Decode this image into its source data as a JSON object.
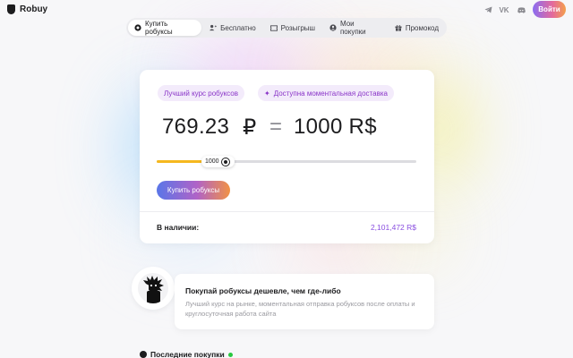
{
  "header": {
    "brand": "Robuy",
    "login_label": "Войти",
    "social": [
      "telegram-icon",
      "vk-icon",
      "discord-icon"
    ]
  },
  "nav": {
    "tabs": [
      {
        "label": "Купить робуксы",
        "icon": "robux-icon",
        "active": true
      },
      {
        "label": "Бесплатно",
        "icon": "user-plus-icon",
        "active": false
      },
      {
        "label": "Розыгрыш",
        "icon": "ticket-icon",
        "active": false
      },
      {
        "label": "Мои покупки",
        "icon": "user-circle-icon",
        "active": false
      },
      {
        "label": "Промокод",
        "icon": "gift-icon",
        "active": false
      }
    ]
  },
  "exchange": {
    "tag_best_rate": "Лучший курс робуксов",
    "tag_instant": "Доступна моментальная доставка",
    "rub_amount": "769.23",
    "rub_sign": "₽",
    "equals": "=",
    "robux_amount": "1000 R$",
    "slider_value": "1000",
    "slider_fill_fraction": 0.19,
    "buy_label": "Купить робуксы",
    "stock_label": "В наличии:",
    "stock_value": "2,101,472 R$"
  },
  "promo": {
    "title": "Покупай робуксы дешевле, чем где-либо",
    "text": "Лучший курс на рынке, моментальная отправка робуксов после оплаты и круглосуточная работа сайта"
  },
  "recent": {
    "title": "Последние покупки"
  },
  "colors": {
    "accent_purple": "#8a35c8",
    "stock_purple": "#8a4fe0",
    "slider_yellow": "#f5b81f",
    "live_green": "#28c840"
  }
}
